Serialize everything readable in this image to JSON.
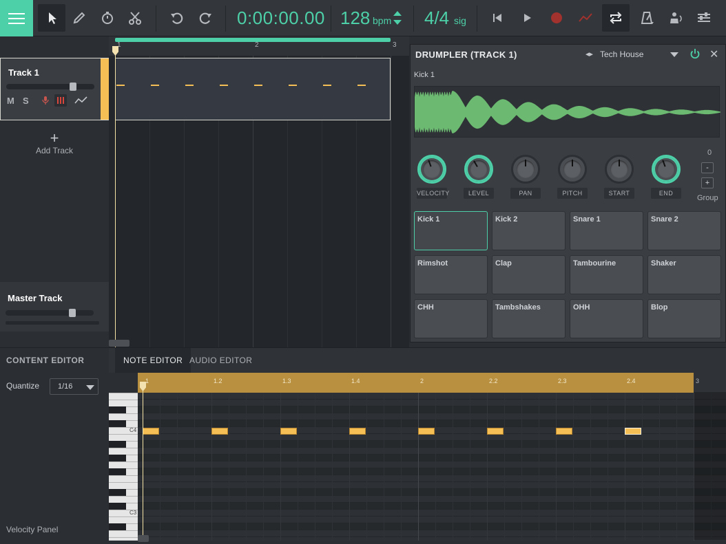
{
  "toolbar": {
    "time": "0:00:00.00",
    "bpm": "128",
    "bpm_unit": "bpm",
    "signature": "4/4",
    "signature_unit": "sig",
    "accent": "#4dd0a7"
  },
  "tracks": {
    "track1": {
      "name": "Track 1",
      "mute": "M",
      "solo": "S",
      "color": "#f6bf55"
    },
    "add_track": "Add Track",
    "master": "Master Track"
  },
  "ruler": {
    "labels": [
      "1",
      "2",
      "3"
    ]
  },
  "drumpler": {
    "title": "DRUMPLER (TRACK 1)",
    "preset": "Tech House",
    "sample": "Kick 1",
    "knobs": [
      "VELOCITY",
      "LEVEL",
      "PAN",
      "PITCH",
      "START",
      "END"
    ],
    "group_value": "0",
    "group_minus": "-",
    "group_plus": "+",
    "group_label": "Group",
    "pads": [
      "Kick 1",
      "Kick 2",
      "Snare 1",
      "Snare 2",
      "Rimshot",
      "Clap",
      "Tambourine",
      "Shaker",
      "CHH",
      "Tambshakes",
      "OHH",
      "Blop"
    ],
    "selected_pad": "Kick 1"
  },
  "editor": {
    "title": "CONTENT EDITOR",
    "tabs": [
      "NOTE EDITOR",
      "AUDIO EDITOR"
    ],
    "active_tab": "NOTE EDITOR",
    "quantize_label": "Quantize",
    "quantize_value": "1/16",
    "velocity_panel": "Velocity Panel",
    "ruler_labels": [
      "1",
      "1.2",
      "1.3",
      "1.4",
      "2",
      "2.2",
      "2.3",
      "2.4",
      "3"
    ],
    "key_labels": [
      "C4",
      "C3"
    ]
  }
}
